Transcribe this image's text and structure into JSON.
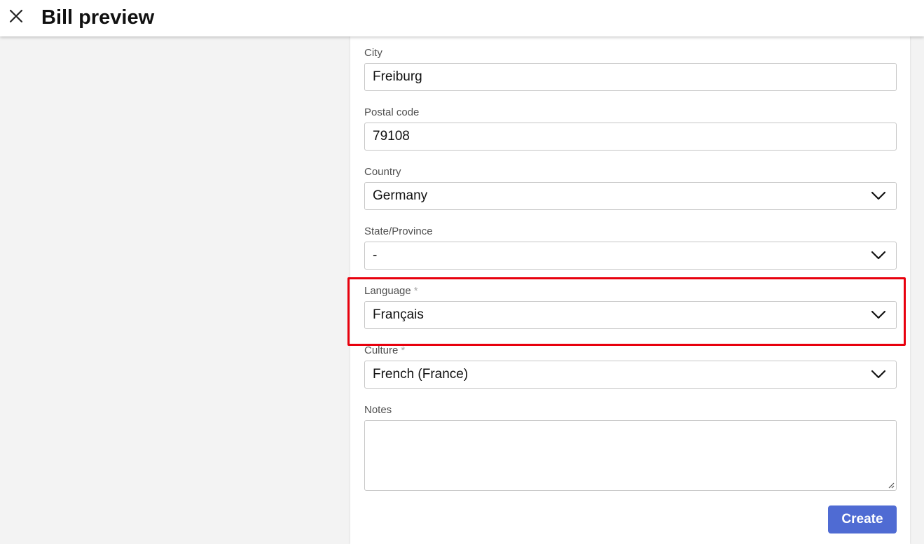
{
  "header": {
    "title": "Bill preview",
    "close_icon": "close-icon"
  },
  "form": {
    "city": {
      "label": "City",
      "value": "Freiburg"
    },
    "postal_code": {
      "label": "Postal code",
      "value": "79108"
    },
    "country": {
      "label": "Country",
      "value": "Germany",
      "icon": "chevron-down-icon"
    },
    "state_province": {
      "label": "State/Province",
      "value": "-",
      "icon": "chevron-down-icon"
    },
    "language": {
      "label": "Language",
      "required_mark": "*",
      "value": "Français",
      "icon": "chevron-down-icon"
    },
    "culture": {
      "label": "Culture",
      "required_mark": "*",
      "value": "French (France)",
      "icon": "chevron-down-icon"
    },
    "notes": {
      "label": "Notes",
      "value": ""
    }
  },
  "actions": {
    "create_label": "Create"
  },
  "colors": {
    "accent": "#4f6bd3",
    "highlight": "#e8000d",
    "background": "#f3f3f3",
    "panel": "#ffffff"
  }
}
